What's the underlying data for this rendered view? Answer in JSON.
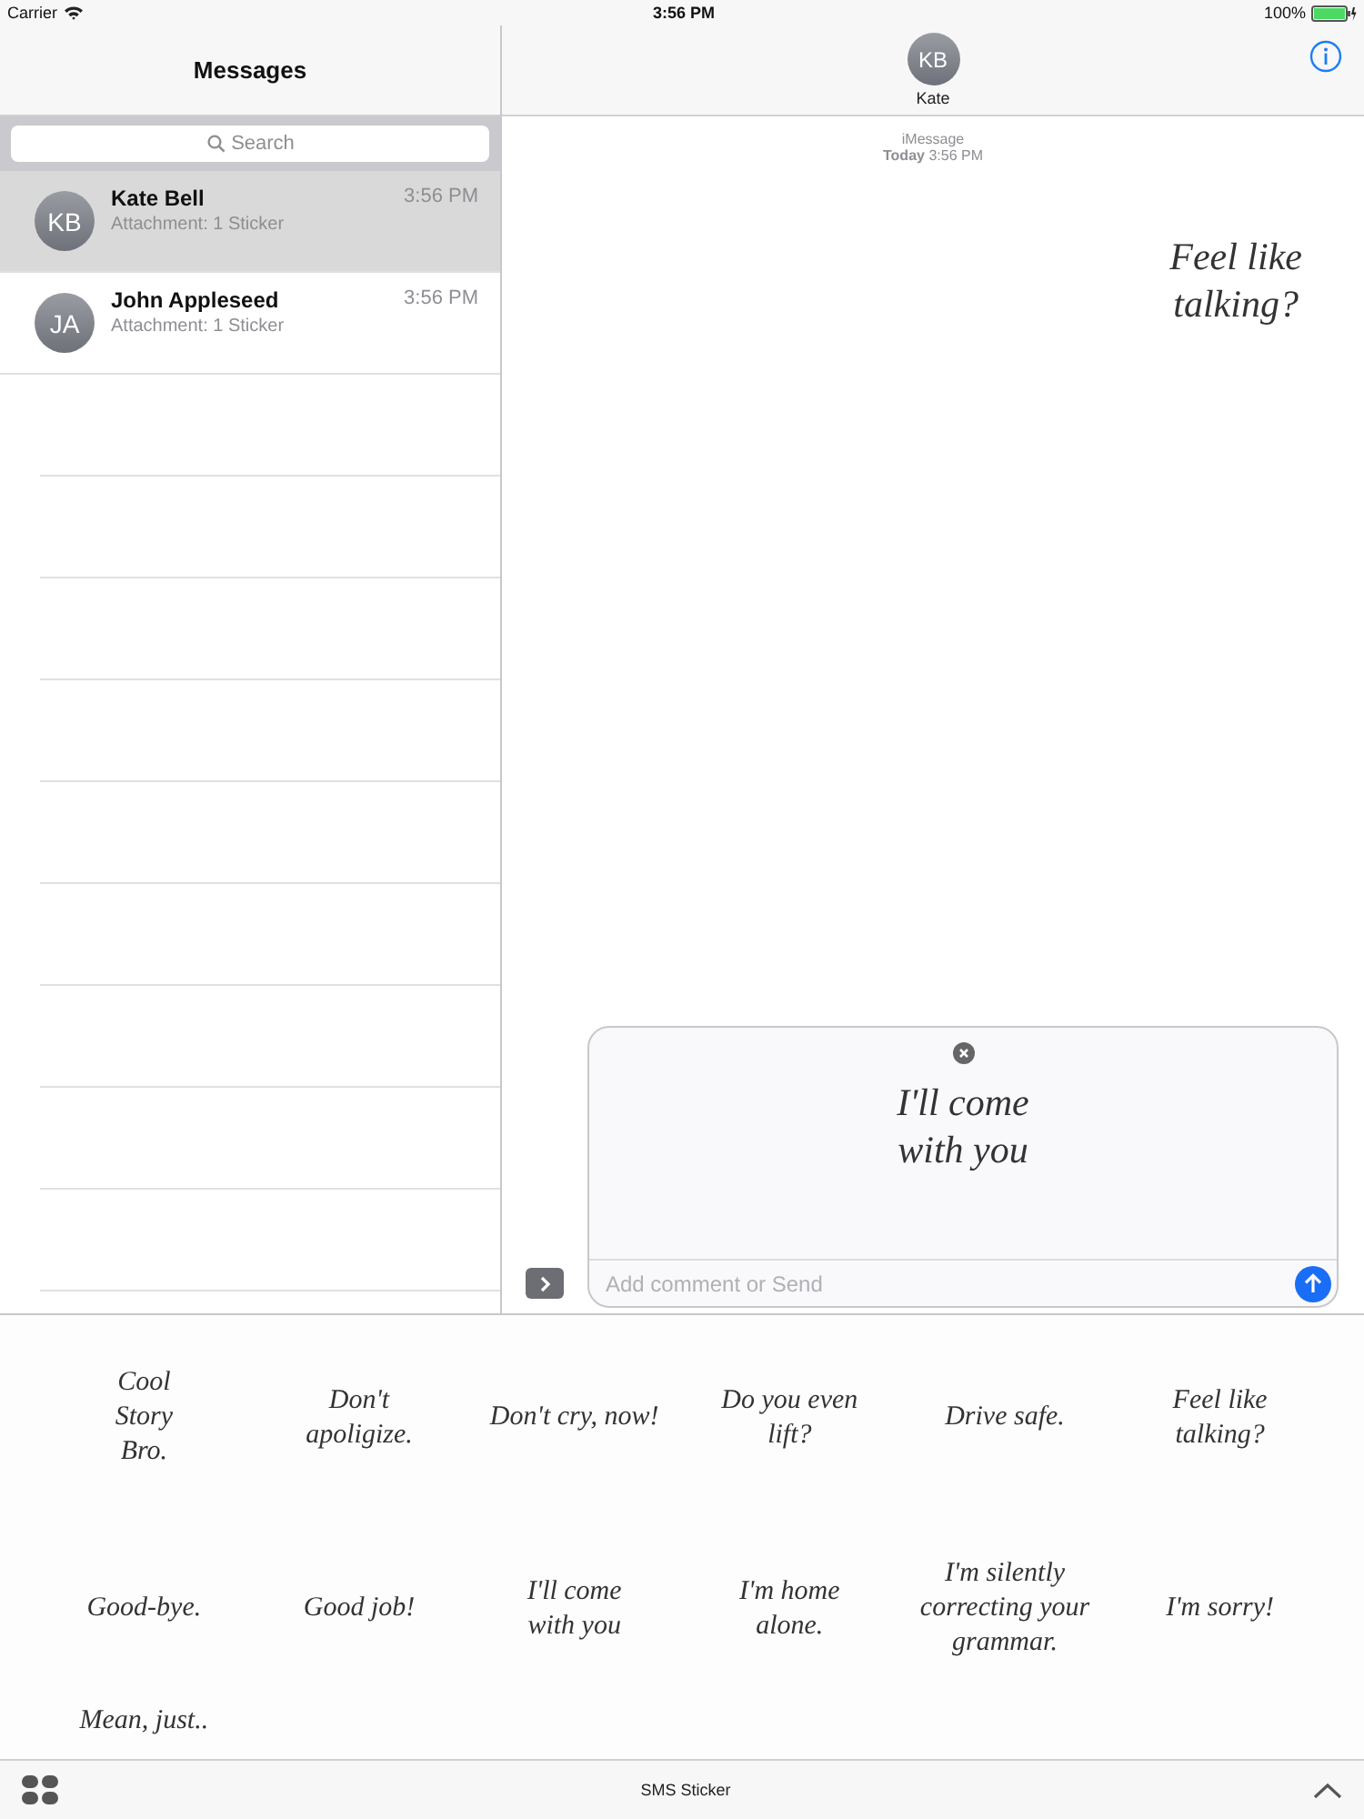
{
  "status_bar": {
    "carrier": "Carrier",
    "time": "3:56 PM",
    "battery": "100%"
  },
  "sidebar": {
    "title": "Messages",
    "search": {
      "placeholder": "Search"
    },
    "conversations": [
      {
        "initials": "KB",
        "name": "Kate Bell",
        "time": "3:56 PM",
        "preview": "Attachment: 1 Sticker",
        "selected": true
      },
      {
        "initials": "JA",
        "name": "John Appleseed",
        "time": "3:56 PM",
        "preview": "Attachment: 1 Sticker",
        "selected": false
      }
    ]
  },
  "conversation": {
    "initials": "KB",
    "name": "Kate",
    "service": "iMessage",
    "day": "Today",
    "time": "3:56 PM",
    "sticker": "Feel like\ntalking?"
  },
  "compose": {
    "sticker": "I'll come\nwith you",
    "placeholder": "Add comment or Send"
  },
  "sticker_drawer": {
    "stickers": [
      {
        "text": "Cool\nStory\nBro."
      },
      {
        "text": "Don't\napoligize."
      },
      {
        "text": "Don't cry, now!"
      },
      {
        "text": "Do you even\nlift?"
      },
      {
        "text": "Drive safe."
      },
      {
        "text": "Feel like\ntalking?"
      },
      {
        "text": "Good-bye."
      },
      {
        "text": "Good job!"
      },
      {
        "text": "I'll come\nwith you"
      },
      {
        "text": "I'm home\nalone."
      },
      {
        "text": "I'm silently\ncorrecting your\ngrammar."
      },
      {
        "text": "I'm sorry!"
      },
      {
        "text": "Mean, just.."
      }
    ],
    "app_name": "SMS Sticker"
  }
}
